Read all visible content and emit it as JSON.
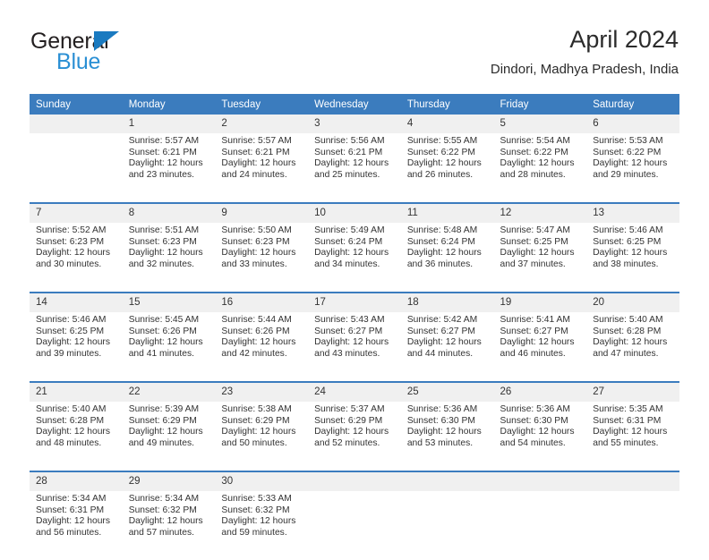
{
  "brand": {
    "name_top": "General",
    "name_bottom": "Blue",
    "triangle_color": "#1a7ac0",
    "blue_text_color": "#2a8fd4"
  },
  "header": {
    "title": "April 2024",
    "subtitle": "Dindori, Madhya Pradesh, India"
  },
  "theme": {
    "header_blue": "#3b7cbe",
    "daynum_band": "#f0f0f0",
    "text": "#333333"
  },
  "weekdays": [
    "Sunday",
    "Monday",
    "Tuesday",
    "Wednesday",
    "Thursday",
    "Friday",
    "Saturday"
  ],
  "weeks": [
    [
      {
        "day": "",
        "sunrise": "",
        "sunset": "",
        "daylight1": "",
        "daylight2": ""
      },
      {
        "day": "1",
        "sunrise": "Sunrise: 5:57 AM",
        "sunset": "Sunset: 6:21 PM",
        "daylight1": "Daylight: 12 hours",
        "daylight2": "and 23 minutes."
      },
      {
        "day": "2",
        "sunrise": "Sunrise: 5:57 AM",
        "sunset": "Sunset: 6:21 PM",
        "daylight1": "Daylight: 12 hours",
        "daylight2": "and 24 minutes."
      },
      {
        "day": "3",
        "sunrise": "Sunrise: 5:56 AM",
        "sunset": "Sunset: 6:21 PM",
        "daylight1": "Daylight: 12 hours",
        "daylight2": "and 25 minutes."
      },
      {
        "day": "4",
        "sunrise": "Sunrise: 5:55 AM",
        "sunset": "Sunset: 6:22 PM",
        "daylight1": "Daylight: 12 hours",
        "daylight2": "and 26 minutes."
      },
      {
        "day": "5",
        "sunrise": "Sunrise: 5:54 AM",
        "sunset": "Sunset: 6:22 PM",
        "daylight1": "Daylight: 12 hours",
        "daylight2": "and 28 minutes."
      },
      {
        "day": "6",
        "sunrise": "Sunrise: 5:53 AM",
        "sunset": "Sunset: 6:22 PM",
        "daylight1": "Daylight: 12 hours",
        "daylight2": "and 29 minutes."
      }
    ],
    [
      {
        "day": "7",
        "sunrise": "Sunrise: 5:52 AM",
        "sunset": "Sunset: 6:23 PM",
        "daylight1": "Daylight: 12 hours",
        "daylight2": "and 30 minutes."
      },
      {
        "day": "8",
        "sunrise": "Sunrise: 5:51 AM",
        "sunset": "Sunset: 6:23 PM",
        "daylight1": "Daylight: 12 hours",
        "daylight2": "and 32 minutes."
      },
      {
        "day": "9",
        "sunrise": "Sunrise: 5:50 AM",
        "sunset": "Sunset: 6:23 PM",
        "daylight1": "Daylight: 12 hours",
        "daylight2": "and 33 minutes."
      },
      {
        "day": "10",
        "sunrise": "Sunrise: 5:49 AM",
        "sunset": "Sunset: 6:24 PM",
        "daylight1": "Daylight: 12 hours",
        "daylight2": "and 34 minutes."
      },
      {
        "day": "11",
        "sunrise": "Sunrise: 5:48 AM",
        "sunset": "Sunset: 6:24 PM",
        "daylight1": "Daylight: 12 hours",
        "daylight2": "and 36 minutes."
      },
      {
        "day": "12",
        "sunrise": "Sunrise: 5:47 AM",
        "sunset": "Sunset: 6:25 PM",
        "daylight1": "Daylight: 12 hours",
        "daylight2": "and 37 minutes."
      },
      {
        "day": "13",
        "sunrise": "Sunrise: 5:46 AM",
        "sunset": "Sunset: 6:25 PM",
        "daylight1": "Daylight: 12 hours",
        "daylight2": "and 38 minutes."
      }
    ],
    [
      {
        "day": "14",
        "sunrise": "Sunrise: 5:46 AM",
        "sunset": "Sunset: 6:25 PM",
        "daylight1": "Daylight: 12 hours",
        "daylight2": "and 39 minutes."
      },
      {
        "day": "15",
        "sunrise": "Sunrise: 5:45 AM",
        "sunset": "Sunset: 6:26 PM",
        "daylight1": "Daylight: 12 hours",
        "daylight2": "and 41 minutes."
      },
      {
        "day": "16",
        "sunrise": "Sunrise: 5:44 AM",
        "sunset": "Sunset: 6:26 PM",
        "daylight1": "Daylight: 12 hours",
        "daylight2": "and 42 minutes."
      },
      {
        "day": "17",
        "sunrise": "Sunrise: 5:43 AM",
        "sunset": "Sunset: 6:27 PM",
        "daylight1": "Daylight: 12 hours",
        "daylight2": "and 43 minutes."
      },
      {
        "day": "18",
        "sunrise": "Sunrise: 5:42 AM",
        "sunset": "Sunset: 6:27 PM",
        "daylight1": "Daylight: 12 hours",
        "daylight2": "and 44 minutes."
      },
      {
        "day": "19",
        "sunrise": "Sunrise: 5:41 AM",
        "sunset": "Sunset: 6:27 PM",
        "daylight1": "Daylight: 12 hours",
        "daylight2": "and 46 minutes."
      },
      {
        "day": "20",
        "sunrise": "Sunrise: 5:40 AM",
        "sunset": "Sunset: 6:28 PM",
        "daylight1": "Daylight: 12 hours",
        "daylight2": "and 47 minutes."
      }
    ],
    [
      {
        "day": "21",
        "sunrise": "Sunrise: 5:40 AM",
        "sunset": "Sunset: 6:28 PM",
        "daylight1": "Daylight: 12 hours",
        "daylight2": "and 48 minutes."
      },
      {
        "day": "22",
        "sunrise": "Sunrise: 5:39 AM",
        "sunset": "Sunset: 6:29 PM",
        "daylight1": "Daylight: 12 hours",
        "daylight2": "and 49 minutes."
      },
      {
        "day": "23",
        "sunrise": "Sunrise: 5:38 AM",
        "sunset": "Sunset: 6:29 PM",
        "daylight1": "Daylight: 12 hours",
        "daylight2": "and 50 minutes."
      },
      {
        "day": "24",
        "sunrise": "Sunrise: 5:37 AM",
        "sunset": "Sunset: 6:29 PM",
        "daylight1": "Daylight: 12 hours",
        "daylight2": "and 52 minutes."
      },
      {
        "day": "25",
        "sunrise": "Sunrise: 5:36 AM",
        "sunset": "Sunset: 6:30 PM",
        "daylight1": "Daylight: 12 hours",
        "daylight2": "and 53 minutes."
      },
      {
        "day": "26",
        "sunrise": "Sunrise: 5:36 AM",
        "sunset": "Sunset: 6:30 PM",
        "daylight1": "Daylight: 12 hours",
        "daylight2": "and 54 minutes."
      },
      {
        "day": "27",
        "sunrise": "Sunrise: 5:35 AM",
        "sunset": "Sunset: 6:31 PM",
        "daylight1": "Daylight: 12 hours",
        "daylight2": "and 55 minutes."
      }
    ],
    [
      {
        "day": "28",
        "sunrise": "Sunrise: 5:34 AM",
        "sunset": "Sunset: 6:31 PM",
        "daylight1": "Daylight: 12 hours",
        "daylight2": "and 56 minutes."
      },
      {
        "day": "29",
        "sunrise": "Sunrise: 5:34 AM",
        "sunset": "Sunset: 6:32 PM",
        "daylight1": "Daylight: 12 hours",
        "daylight2": "and 57 minutes."
      },
      {
        "day": "30",
        "sunrise": "Sunrise: 5:33 AM",
        "sunset": "Sunset: 6:32 PM",
        "daylight1": "Daylight: 12 hours",
        "daylight2": "and 59 minutes."
      },
      {
        "day": "",
        "sunrise": "",
        "sunset": "",
        "daylight1": "",
        "daylight2": ""
      },
      {
        "day": "",
        "sunrise": "",
        "sunset": "",
        "daylight1": "",
        "daylight2": ""
      },
      {
        "day": "",
        "sunrise": "",
        "sunset": "",
        "daylight1": "",
        "daylight2": ""
      },
      {
        "day": "",
        "sunrise": "",
        "sunset": "",
        "daylight1": "",
        "daylight2": ""
      }
    ]
  ]
}
